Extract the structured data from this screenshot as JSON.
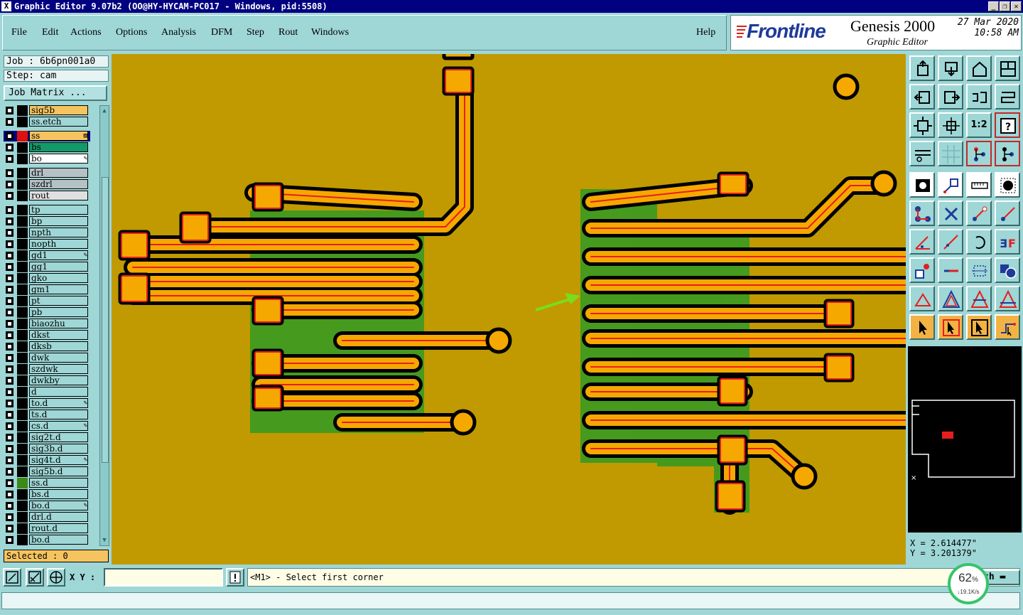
{
  "window": {
    "title": "Graphic Editor 9.07b2 (OO@HY-HYCAM-PC017 - Windows, pid:5508)",
    "buttons": [
      "_",
      "❐",
      "✕"
    ]
  },
  "menu": {
    "items": [
      "File",
      "Edit",
      "Actions",
      "Options",
      "Analysis",
      "DFM",
      "Step",
      "Rout",
      "Windows"
    ],
    "help": "Help"
  },
  "brand": {
    "logo": "Frontline",
    "product": "Genesis 2000",
    "subtitle": "Graphic Editor",
    "date": "27 Mar 2020",
    "time": "10:58 AM"
  },
  "job": {
    "job_line": "Job : 6b6pn001a0",
    "step_line": "Step: cam",
    "matrix_button": "Job Matrix ..."
  },
  "layers": [
    {
      "name": "sig5b",
      "swatch": "#000000",
      "fill": "#f5c460",
      "flag": ""
    },
    {
      "name": "ss.etch",
      "swatch": "#000000",
      "fill": "#9fd6d6",
      "flag": ""
    },
    {
      "name": "ss",
      "swatch": "#e01010",
      "fill": "#f5c460",
      "flag": "▨",
      "active": true
    },
    {
      "name": "bs",
      "swatch": "#000000",
      "fill": "#139a6a",
      "flag": ""
    },
    {
      "name": "bo",
      "swatch": "#000000",
      "fill": "#ffffff",
      "flag": "✎"
    },
    {
      "name": "drl",
      "swatch": "#000000",
      "fill": "#b6c1c6",
      "flag": ""
    },
    {
      "name": "szdrl",
      "swatch": "#000000",
      "fill": "#b6c1c6",
      "flag": ""
    },
    {
      "name": "rout",
      "swatch": "#000000",
      "fill": "#e0e0e0",
      "flag": ""
    },
    {
      "name": "tp",
      "swatch": "#000000",
      "fill": "#9fd6d6",
      "flag": ""
    },
    {
      "name": "bp",
      "swatch": "#000000",
      "fill": "#9fd6d6",
      "flag": ""
    },
    {
      "name": "npth",
      "swatch": "#000000",
      "fill": "#9fd6d6",
      "flag": ""
    },
    {
      "name": "nopth",
      "swatch": "#000000",
      "fill": "#9fd6d6",
      "flag": ""
    },
    {
      "name": "gd1",
      "swatch": "#000000",
      "fill": "#9fd6d6",
      "flag": "✎"
    },
    {
      "name": "gg1",
      "swatch": "#000000",
      "fill": "#9fd6d6",
      "flag": ""
    },
    {
      "name": "gko",
      "swatch": "#000000",
      "fill": "#9fd6d6",
      "flag": ""
    },
    {
      "name": "gm1",
      "swatch": "#000000",
      "fill": "#9fd6d6",
      "flag": ""
    },
    {
      "name": "pt",
      "swatch": "#000000",
      "fill": "#9fd6d6",
      "flag": ""
    },
    {
      "name": "pb",
      "swatch": "#000000",
      "fill": "#9fd6d6",
      "flag": ""
    },
    {
      "name": "biaozhu",
      "swatch": "#000000",
      "fill": "#9fd6d6",
      "flag": ""
    },
    {
      "name": "dkst",
      "swatch": "#000000",
      "fill": "#9fd6d6",
      "flag": ""
    },
    {
      "name": "dksb",
      "swatch": "#000000",
      "fill": "#9fd6d6",
      "flag": ""
    },
    {
      "name": "dwk",
      "swatch": "#000000",
      "fill": "#9fd6d6",
      "flag": ""
    },
    {
      "name": "szdwk",
      "swatch": "#000000",
      "fill": "#9fd6d6",
      "flag": ""
    },
    {
      "name": "dwkby",
      "swatch": "#000000",
      "fill": "#9fd6d6",
      "flag": ""
    },
    {
      "name": "d",
      "swatch": "#000000",
      "fill": "#9fd6d6",
      "flag": ""
    },
    {
      "name": "to.d",
      "swatch": "#000000",
      "fill": "#9fd6d6",
      "flag": "✎"
    },
    {
      "name": "ts.d",
      "swatch": "#000000",
      "fill": "#9fd6d6",
      "flag": ""
    },
    {
      "name": "cs.d",
      "swatch": "#000000",
      "fill": "#9fd6d6",
      "flag": "✎"
    },
    {
      "name": "sig2t.d",
      "swatch": "#000000",
      "fill": "#9fd6d6",
      "flag": ""
    },
    {
      "name": "sig3b.d",
      "swatch": "#000000",
      "fill": "#9fd6d6",
      "flag": ""
    },
    {
      "name": "sig4t.d",
      "swatch": "#000000",
      "fill": "#9fd6d6",
      "flag": "✎"
    },
    {
      "name": "sig5b.d",
      "swatch": "#000000",
      "fill": "#9fd6d6",
      "flag": ""
    },
    {
      "name": "ss.d",
      "swatch": "#3a8a1a",
      "fill": "#9fd6d6",
      "flag": ""
    },
    {
      "name": "bs.d",
      "swatch": "#000000",
      "fill": "#9fd6d6",
      "flag": ""
    },
    {
      "name": "bo.d",
      "swatch": "#000000",
      "fill": "#9fd6d6",
      "flag": "✎"
    },
    {
      "name": "drl.d",
      "swatch": "#000000",
      "fill": "#9fd6d6",
      "flag": ""
    },
    {
      "name": "rout.d",
      "swatch": "#000000",
      "fill": "#9fd6d6",
      "flag": ""
    },
    {
      "name": "bo.d",
      "swatch": "#000000",
      "fill": "#9fd6d6",
      "flag": ""
    }
  ],
  "selected": "Selected : 0",
  "coords": {
    "x": "X = 2.614477\"",
    "y": "Y = 3.201379\""
  },
  "bottom": {
    "xy_label": "X Y :",
    "xy_value": "",
    "prompt": "<M1> - Select first corner",
    "mode": "ch"
  },
  "network": {
    "percent": "62",
    "unit": "%",
    "speed": "↓19.1K/s"
  },
  "toolbar": {
    "one_to_one": "1:2",
    "help_mark": "?"
  },
  "colors": {
    "board": "#c09a00",
    "copper_outline": "#000000",
    "pad_fill": "#f5a800",
    "highlight": "#e61e1e",
    "soldermask": "#3f9a20",
    "panel": "#9fd6d6"
  }
}
